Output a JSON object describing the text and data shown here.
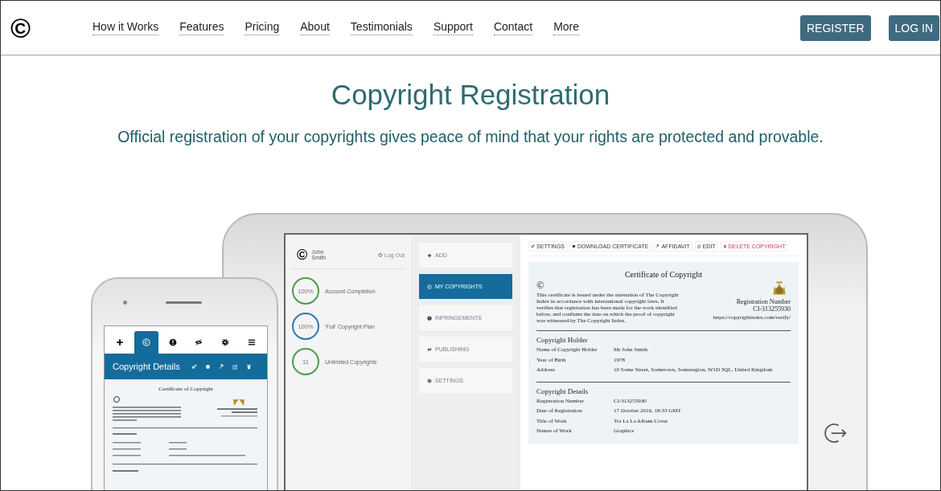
{
  "nav": {
    "logo": "©",
    "links": [
      "How it Works",
      "Features",
      "Pricing",
      "About",
      "Testimonials",
      "Support",
      "Contact",
      "More"
    ],
    "buttons": [
      "REGISTER",
      "LOG IN"
    ]
  },
  "hero": {
    "title": "Copyright Registration",
    "subtitle": "Official registration of your copyrights gives peace of mind that your rights are protected and provable."
  },
  "tablet": {
    "user": {
      "logo": "©",
      "first_name": "John",
      "last_name": "Smith",
      "logout": "Log Out"
    },
    "stats": [
      {
        "value": "100%",
        "label": "Account Completion",
        "color": "#4f9a4f"
      },
      {
        "value": "100%",
        "label": "'Full' Copyright Plan",
        "color": "#2f78b8"
      },
      {
        "value": "11",
        "label": "Unlimited Copyrights",
        "color": "#4f9a4f"
      }
    ],
    "menu": [
      {
        "label": "ADD",
        "selected": false
      },
      {
        "label": "MY COPYRIGHTS",
        "selected": true
      },
      {
        "label": "INFRINGEMENTS",
        "selected": false
      },
      {
        "label": "PUBLISHING",
        "selected": false
      },
      {
        "label": "SETTINGS",
        "selected": false
      }
    ],
    "toolbar": [
      {
        "label": "SETTINGS",
        "kind": "normal"
      },
      {
        "label": "DOWNLOAD CERTIFICATE",
        "kind": "normal"
      },
      {
        "label": "AFFIDAVIT",
        "kind": "normal"
      },
      {
        "label": "EDIT",
        "kind": "normal"
      },
      {
        "label": "DELETE COPYRIGHT",
        "kind": "danger"
      }
    ],
    "certificate": {
      "title": "Certificate of Copyright",
      "mark": "©",
      "statement": "This certificate is issued under the attestation of The Copyright Index in accordance with international copyright laws. It verifies that registration has been made for the work identified below, and confirms the date on which the proof of copyright was witnessed by The Copyright Index.",
      "reg_label": "Registration Number",
      "reg_number": "CI-313255930",
      "url": "https://copyrightindex.com/verify/",
      "sections": [
        {
          "heading": "Copyright Holder",
          "rows": [
            {
              "label": "Name of Copyright Holder",
              "value": "Mr John Smith"
            },
            {
              "label": "Year of Birth",
              "value": "1978"
            },
            {
              "label": "Address",
              "value": "10 Some Street, Sometown, Someregion, W1D 3QL, United Kingdom"
            }
          ]
        },
        {
          "heading": "Copyright Details",
          "rows": [
            {
              "label": "Registration Number",
              "value": "CI-313255930"
            },
            {
              "label": "Date of Registration",
              "value": "17 October 2016, 18:33 GMT"
            },
            {
              "label": "Title of Work",
              "value": "Tra La La Album Cover"
            },
            {
              "label": "Nature of Work",
              "value": "Graphics"
            }
          ]
        }
      ]
    }
  },
  "phone": {
    "tabs": [
      {
        "selected": false
      },
      {
        "selected": true
      },
      {
        "selected": false
      },
      {
        "selected": false
      },
      {
        "selected": false
      },
      {
        "selected": false
      }
    ],
    "header": "Copyright Details",
    "certificate_title": "Certificate of Copyright"
  }
}
